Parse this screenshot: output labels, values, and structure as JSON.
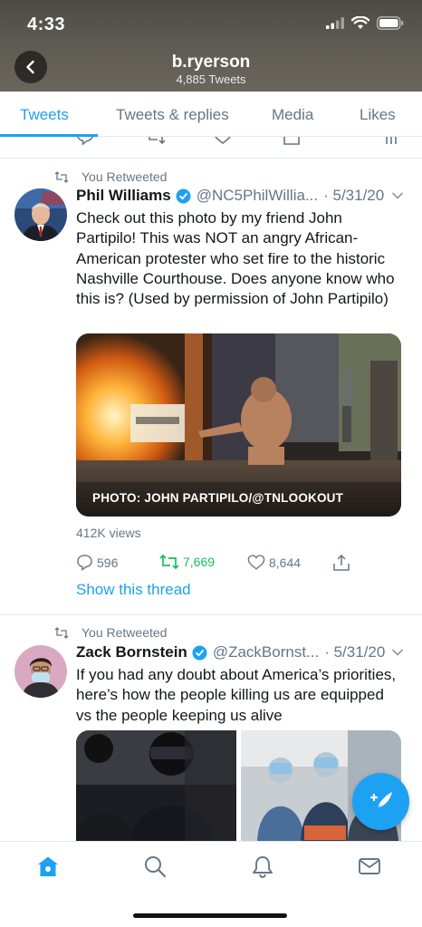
{
  "status_bar": {
    "time": "4:33"
  },
  "profile": {
    "name": "b.ryerson",
    "tweet_count": "4,885 Tweets"
  },
  "tabs": [
    {
      "label": "Tweets",
      "active": true
    },
    {
      "label": "Tweets & replies",
      "active": false
    },
    {
      "label": "Media",
      "active": false
    },
    {
      "label": "Likes",
      "active": false
    }
  ],
  "tweets": [
    {
      "retweet_label": "You Retweeted",
      "name": "Phil Williams",
      "handle": "@NC5PhilWillia...",
      "date": "· 5/31/20",
      "text": "Check out this photo by my friend John Partipilo! This was NOT an angry African-American protester who set fire to the historic Nashville Courthouse. Does anyone know who this is? (Used by permission of John Partipilo)",
      "image_caption": "PHOTO: JOHN PARTIPILO/@TNLOOKOUT",
      "views": "412K views",
      "replies": "596",
      "retweets": "7,669",
      "likes": "8,644",
      "show_thread": "Show this thread"
    },
    {
      "retweet_label": "You Retweeted",
      "name": "Zack Bornstein",
      "handle": "@ZackBornst...",
      "date": "· 5/31/20",
      "text": "If you had any doubt about America’s priorities, here’s how the people killing us are equipped vs the people keeping us alive"
    }
  ],
  "colors": {
    "accent": "#1da1f2",
    "retweet_green": "#17bf63",
    "secondary_text": "#657786"
  },
  "icons": [
    "back-icon",
    "reply-icon",
    "retweet-icon",
    "like-icon",
    "share-icon",
    "verified-icon",
    "chevron-down-icon",
    "home-icon",
    "search-icon",
    "notifications-icon",
    "messages-icon",
    "compose-icon"
  ]
}
